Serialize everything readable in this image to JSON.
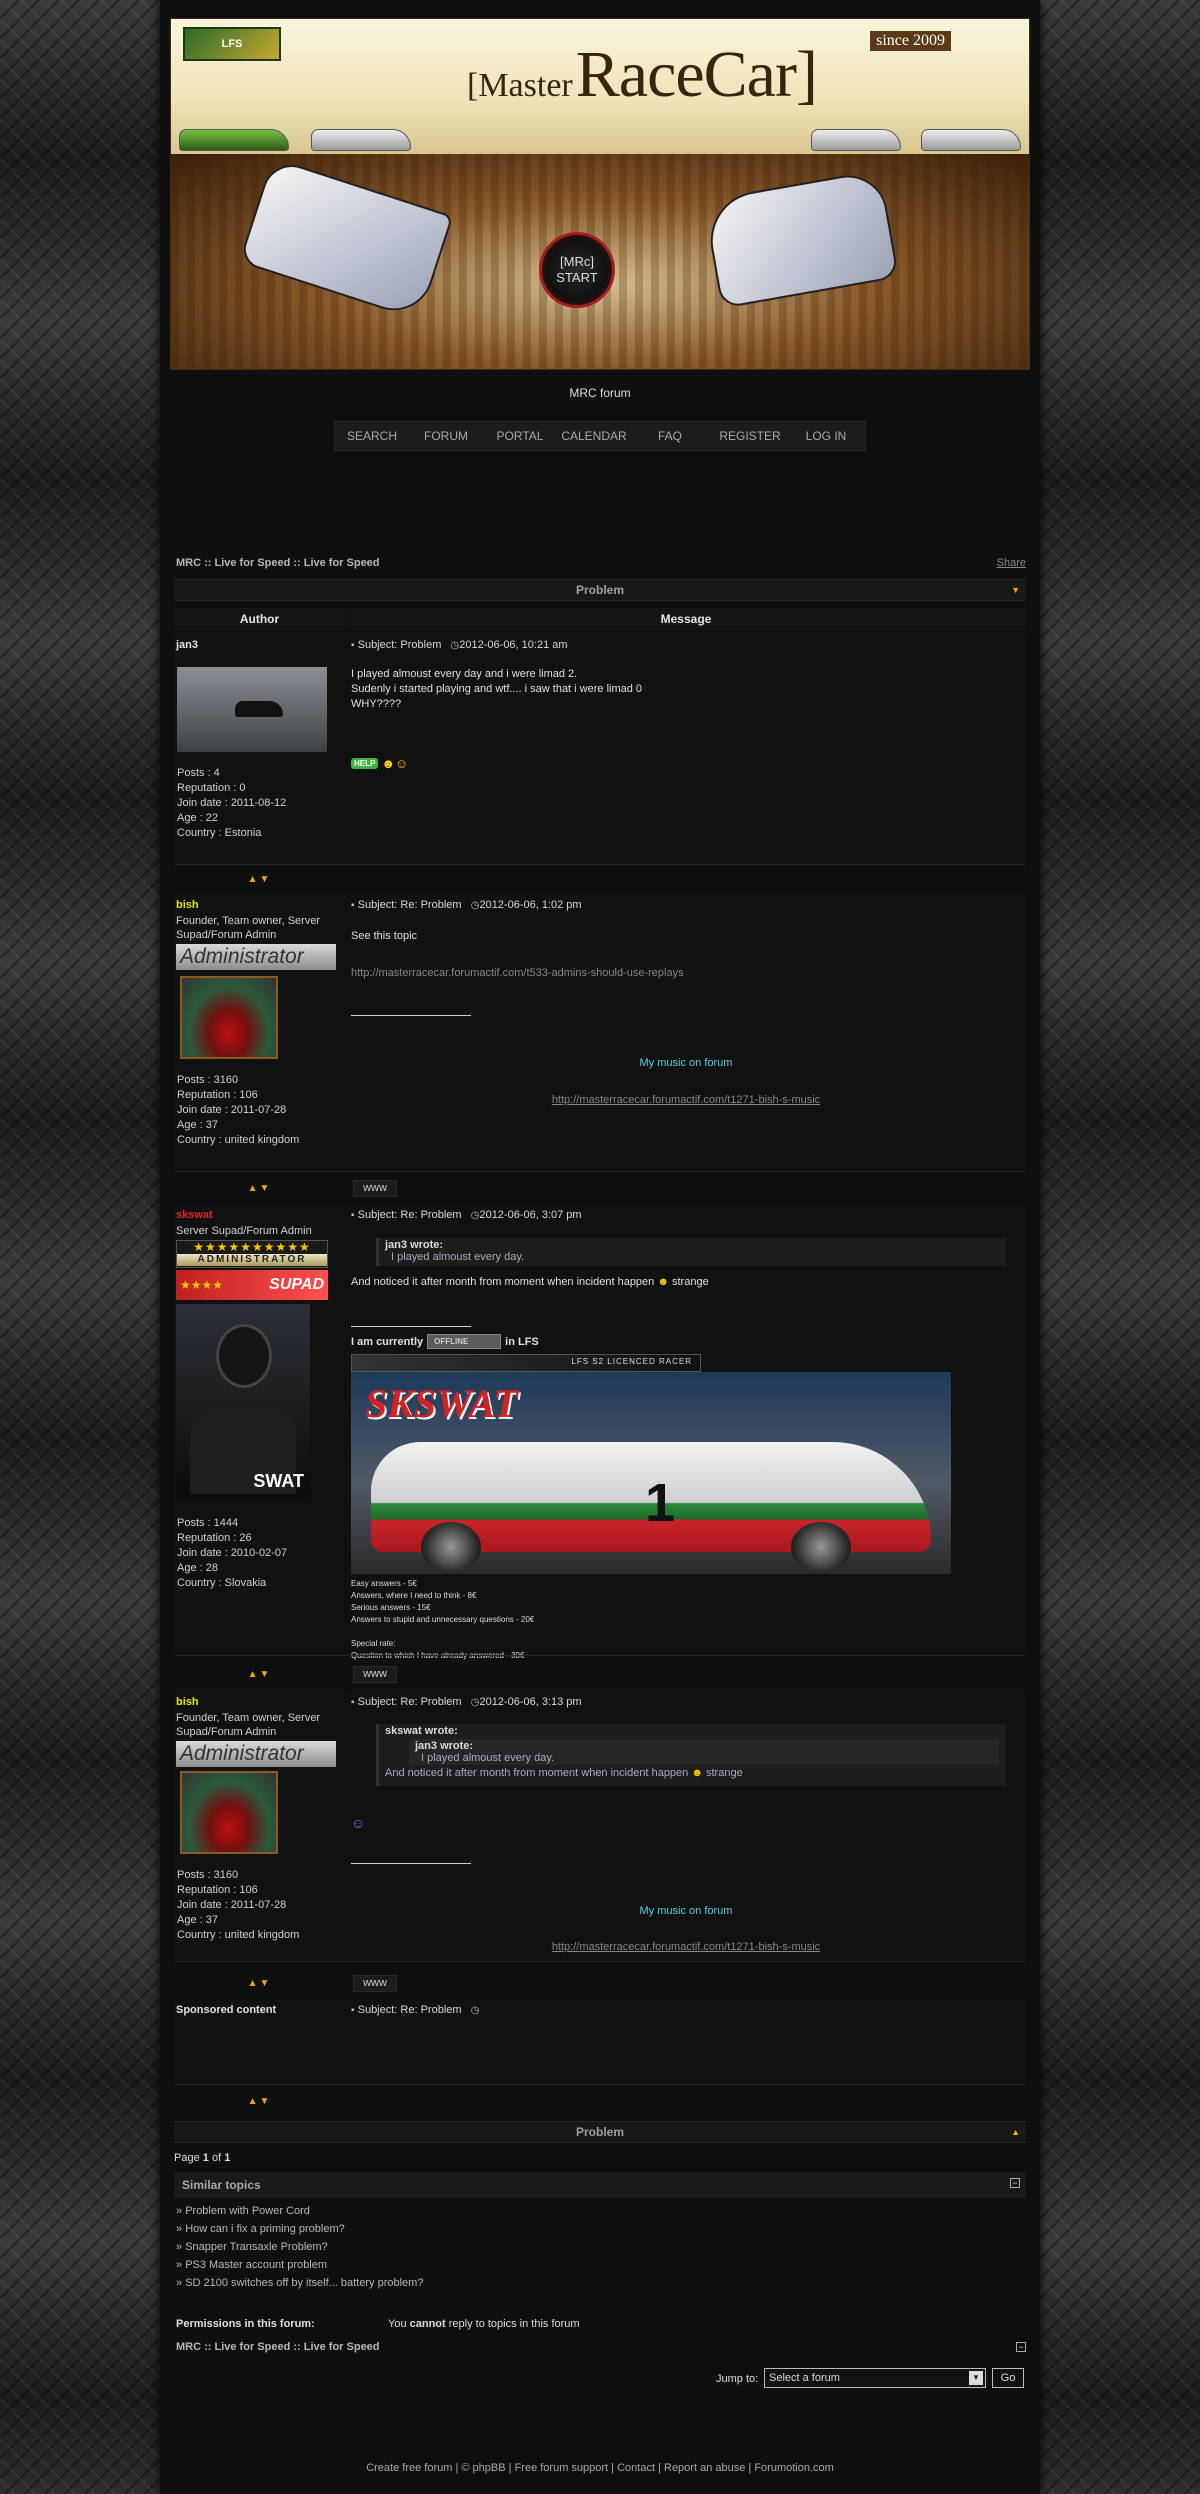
{
  "banner": {
    "title_small": "[Master",
    "title_big": "RaceCar]",
    "since": "since 2009",
    "start_top": "[MRc]",
    "start_bottom": "START"
  },
  "forum_name": "MRC forum",
  "nav": [
    "SEARCH",
    "FORUM",
    "PORTAL",
    "CALENDAR",
    "FAQ",
    "REGISTER",
    "LOG IN"
  ],
  "breadcrumb": "MRC :: Live for Speed :: Live for Speed",
  "share": "Share",
  "topic_title": "Problem",
  "col_author": "Author",
  "col_message": "Message",
  "posts": [
    {
      "author": "jan3",
      "subject": "Subject: Problem",
      "date": "2012-06-06, 10:21 am",
      "lines": [
        "I played almoust every day and i were limad 2.",
        "Sudenly i started playing and wtf.... i saw that i were limad 0",
        "WHY????"
      ],
      "help": "HELP",
      "stats": [
        "Posts : 4",
        "Reputation : 0",
        "Join date : 2011-08-12",
        "Age : 22",
        "Country : Estonia"
      ]
    },
    {
      "author": "bish",
      "rank": "Founder, Team owner, Server Supad/Forum Admin",
      "rank_image": "Administrator",
      "subject": "Subject: Re: Problem",
      "date": "2012-06-06, 1:02 pm",
      "body": "See this topic",
      "link": "http://masterracecar.forumactif.com/t533-admins-should-use-replays",
      "music": "My music on forum",
      "music_link": "http://masterracecar.forumactif.com/t1271-bish-s-music",
      "stats": [
        "Posts : 3160",
        "Reputation : 106",
        "Join date : 2011-07-28",
        "Age : 37",
        "Country : united kingdom"
      ]
    },
    {
      "author": "skswat",
      "rank": "Server Supad/Forum Admin",
      "rank_image_1": "ADMINISTRATOR",
      "rank_image_2": "SUPAD",
      "avatar_text": "SWAT",
      "subject": "Subject: Re: Problem",
      "date": "2012-06-06, 3:07 pm",
      "quote_author": "jan3 wrote:",
      "quote_text": "I played almoust every day.",
      "body": "And noticed it after month from moment when incident happen",
      "body_end": "strange",
      "sig_prefix": "I am currently",
      "sig_status": "OFFLINE",
      "sig_suffix": "in LFS",
      "licence": "LFS S2 LICENCED RACER",
      "banner_name": "SKSWAT",
      "car_number": "1",
      "price_lines": [
        "Easy answers - 5€",
        "Answers, where I need to think - 8€",
        "Serious answers - 15€",
        "Answers to stupid and unnecessary questions - 20€",
        "",
        "Special rate:",
        "Question to which I have already answered - 30€"
      ],
      "stats": [
        "Posts : 1444",
        "Reputation : 26",
        "Join date : 2010-02-07",
        "Age : 28",
        "Country : Slovakia"
      ]
    },
    {
      "author": "bish",
      "rank": "Founder, Team owner, Server Supad/Forum Admin",
      "rank_image": "Administrator",
      "subject": "Subject: Re: Problem",
      "date": "2012-06-06, 3:13 pm",
      "quote_outer": "skswat wrote:",
      "quote_inner": "jan3 wrote:",
      "quote_inner_text": "I played almoust every day.",
      "quote_outer_text": "And noticed it after month from moment when incident happen",
      "quote_outer_end": "strange",
      "music": "My music on forum",
      "music_link": "http://masterracecar.forumactif.com/t1271-bish-s-music",
      "stats": [
        "Posts : 3160",
        "Reputation : 106",
        "Join date : 2011-07-28",
        "Age : 37",
        "Country : united kingdom"
      ]
    },
    {
      "author": "Sponsored content",
      "subject": "Subject: Re: Problem"
    }
  ],
  "www": "www",
  "page_info": {
    "prefix": "Page",
    "current": "1",
    "of": "of",
    "total": "1"
  },
  "similar": {
    "title": "Similar topics",
    "items": [
      "Problem with Power Cord",
      "How can i fix a priming problem?",
      "Snapper Transaxle Problem?",
      "PS3 Master account problem",
      "SD 2100 switches off by itself... battery problem?"
    ]
  },
  "permissions": {
    "label": "Permissions in this forum:",
    "you": "You",
    "cannot": "cannot",
    "rest": "reply to topics in this forum"
  },
  "jump": {
    "label": "Jump to:",
    "selected": "Select a forum",
    "go": "Go"
  },
  "footer": [
    "Create free forum",
    "© phpBB",
    "Free forum support",
    "Contact",
    "Report an abuse",
    "Forumotion.com"
  ]
}
